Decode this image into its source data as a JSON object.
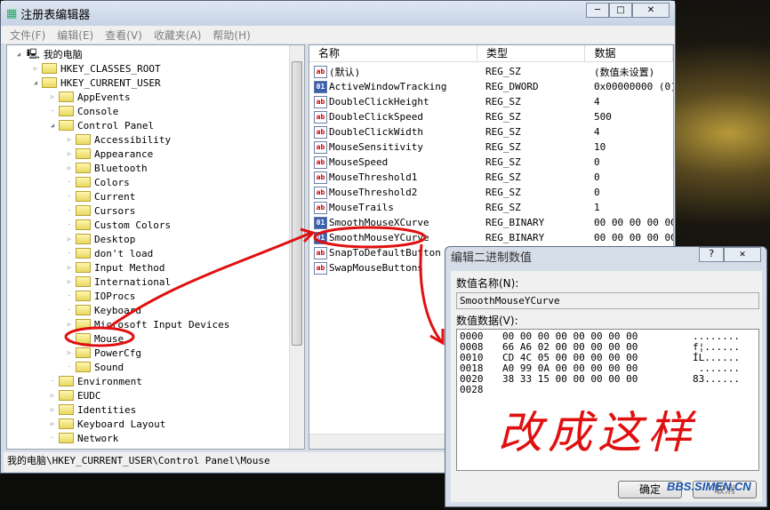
{
  "window": {
    "title": "注册表编辑器",
    "controls": [
      "─",
      "□",
      "✕"
    ]
  },
  "menu": [
    "文件(F)",
    "编辑(E)",
    "查看(V)",
    "收藏夹(A)",
    "帮助(H)"
  ],
  "tree": [
    {
      "label": "我的电脑",
      "level": 0,
      "state": "expanded",
      "icon": "computer-icon"
    },
    {
      "label": "HKEY_CLASSES_ROOT",
      "level": 1,
      "state": "collapsed"
    },
    {
      "label": "HKEY_CURRENT_USER",
      "level": 1,
      "state": "expanded"
    },
    {
      "label": "AppEvents",
      "level": 2,
      "state": "collapsed"
    },
    {
      "label": "Console",
      "level": 2,
      "state": "none"
    },
    {
      "label": "Control Panel",
      "level": 2,
      "state": "expanded"
    },
    {
      "label": "Accessibility",
      "level": 3,
      "state": "collapsed"
    },
    {
      "label": "Appearance",
      "level": 3,
      "state": "collapsed"
    },
    {
      "label": "Bluetooth",
      "level": 3,
      "state": "collapsed"
    },
    {
      "label": "Colors",
      "level": 3,
      "state": "none"
    },
    {
      "label": "Current",
      "level": 3,
      "state": "none"
    },
    {
      "label": "Cursors",
      "level": 3,
      "state": "none"
    },
    {
      "label": "Custom Colors",
      "level": 3,
      "state": "none"
    },
    {
      "label": "Desktop",
      "level": 3,
      "state": "collapsed"
    },
    {
      "label": "don't load",
      "level": 3,
      "state": "none"
    },
    {
      "label": "Input Method",
      "level": 3,
      "state": "collapsed"
    },
    {
      "label": "International",
      "level": 3,
      "state": "collapsed"
    },
    {
      "label": "IOProcs",
      "level": 3,
      "state": "none"
    },
    {
      "label": "Keyboard",
      "level": 3,
      "state": "none"
    },
    {
      "label": "Microsoft Input Devices",
      "level": 3,
      "state": "collapsed"
    },
    {
      "label": "Mouse",
      "level": 3,
      "state": "none",
      "selected": true
    },
    {
      "label": "PowerCfg",
      "level": 3,
      "state": "collapsed"
    },
    {
      "label": "Sound",
      "level": 3,
      "state": "none"
    },
    {
      "label": "Environment",
      "level": 2,
      "state": "none"
    },
    {
      "label": "EUDC",
      "level": 2,
      "state": "collapsed"
    },
    {
      "label": "Identities",
      "level": 2,
      "state": "collapsed"
    },
    {
      "label": "Keyboard Layout",
      "level": 2,
      "state": "collapsed"
    },
    {
      "label": "Network",
      "level": 2,
      "state": "none"
    }
  ],
  "list": {
    "headers": [
      "名称",
      "类型",
      "数据"
    ],
    "rows": [
      {
        "name": "(默认)",
        "type": "REG_SZ",
        "data": "(数值未设置)",
        "icon": "ab"
      },
      {
        "name": "ActiveWindowTracking",
        "type": "REG_DWORD",
        "data": "0x00000000 (0)",
        "icon": "bin"
      },
      {
        "name": "DoubleClickHeight",
        "type": "REG_SZ",
        "data": "4",
        "icon": "ab"
      },
      {
        "name": "DoubleClickSpeed",
        "type": "REG_SZ",
        "data": "500",
        "icon": "ab"
      },
      {
        "name": "DoubleClickWidth",
        "type": "REG_SZ",
        "data": "4",
        "icon": "ab"
      },
      {
        "name": "MouseSensitivity",
        "type": "REG_SZ",
        "data": "10",
        "icon": "ab"
      },
      {
        "name": "MouseSpeed",
        "type": "REG_SZ",
        "data": "0",
        "icon": "ab"
      },
      {
        "name": "MouseThreshold1",
        "type": "REG_SZ",
        "data": "0",
        "icon": "ab"
      },
      {
        "name": "MouseThreshold2",
        "type": "REG_SZ",
        "data": "0",
        "icon": "ab"
      },
      {
        "name": "MouseTrails",
        "type": "REG_SZ",
        "data": "1",
        "icon": "ab"
      },
      {
        "name": "SmoothMouseXCurve",
        "type": "REG_BINARY",
        "data": "00 00 00 00 00",
        "icon": "bin"
      },
      {
        "name": "SmoothMouseYCurve",
        "type": "REG_BINARY",
        "data": "00 00 00 00 00",
        "icon": "bin"
      },
      {
        "name": "SnapToDefaultButton",
        "type": "",
        "data": "",
        "icon": "ab"
      },
      {
        "name": "SwapMouseButtons",
        "type": "",
        "data": "",
        "icon": "ab"
      }
    ]
  },
  "status": "我的电脑\\HKEY_CURRENT_USER\\Control Panel\\Mouse",
  "dialog": {
    "title": "编辑二进制数值",
    "controls": [
      "?",
      "✕"
    ],
    "name_label": "数值名称(N):",
    "name_value": "SmoothMouseYCurve",
    "data_label": "数值数据(V):",
    "hex": [
      {
        "offset": "0000",
        "bytes": "00 00 00 00 00 00 00 00",
        "ascii": "........"
      },
      {
        "offset": "0008",
        "bytes": "66 A6 02 00 00 00 00 00",
        "ascii": "f¦......"
      },
      {
        "offset": "0010",
        "bytes": "CD 4C 05 00 00 00 00 00",
        "ascii": "ÍL......"
      },
      {
        "offset": "0018",
        "bytes": "A0 99 0A 00 00 00 00 00",
        "ascii": " ......."
      },
      {
        "offset": "0020",
        "bytes": "38 33 15 00 00 00 00 00",
        "ascii": "83......"
      },
      {
        "offset": "0028",
        "bytes": "",
        "ascii": ""
      }
    ],
    "ok_label": "确定",
    "cancel_label": "取消"
  },
  "annotation": {
    "text": "改成这样",
    "color": "#e01010"
  },
  "watermark": "BBS.SIMEN.CN"
}
